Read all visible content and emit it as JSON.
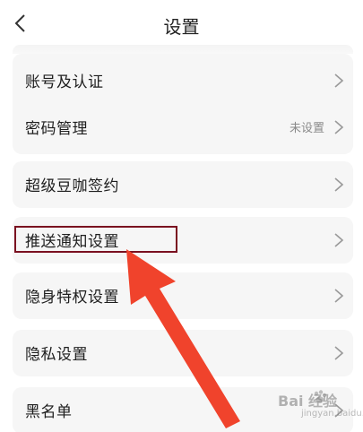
{
  "header": {
    "title": "设置"
  },
  "groups": [
    {
      "items": [
        {
          "label": "账号及认证",
          "value": ""
        },
        {
          "label": "密码管理",
          "value": "未设置"
        }
      ]
    },
    {
      "items": [
        {
          "label": "超级豆咖签约",
          "value": ""
        }
      ]
    },
    {
      "items": [
        {
          "label": "推送通知设置",
          "value": ""
        }
      ]
    },
    {
      "items": [
        {
          "label": "隐身特权设置",
          "value": ""
        }
      ]
    },
    {
      "items": [
        {
          "label": "隐私设置",
          "value": ""
        }
      ]
    },
    {
      "items": [
        {
          "label": "黑名单",
          "value": ""
        }
      ]
    }
  ],
  "annotation": {
    "highlight_color": "#7a1020",
    "arrow_color": "#f0432c"
  },
  "watermark": {
    "text": "Bai 经验",
    "sub": "jingyan.baidu.com"
  }
}
